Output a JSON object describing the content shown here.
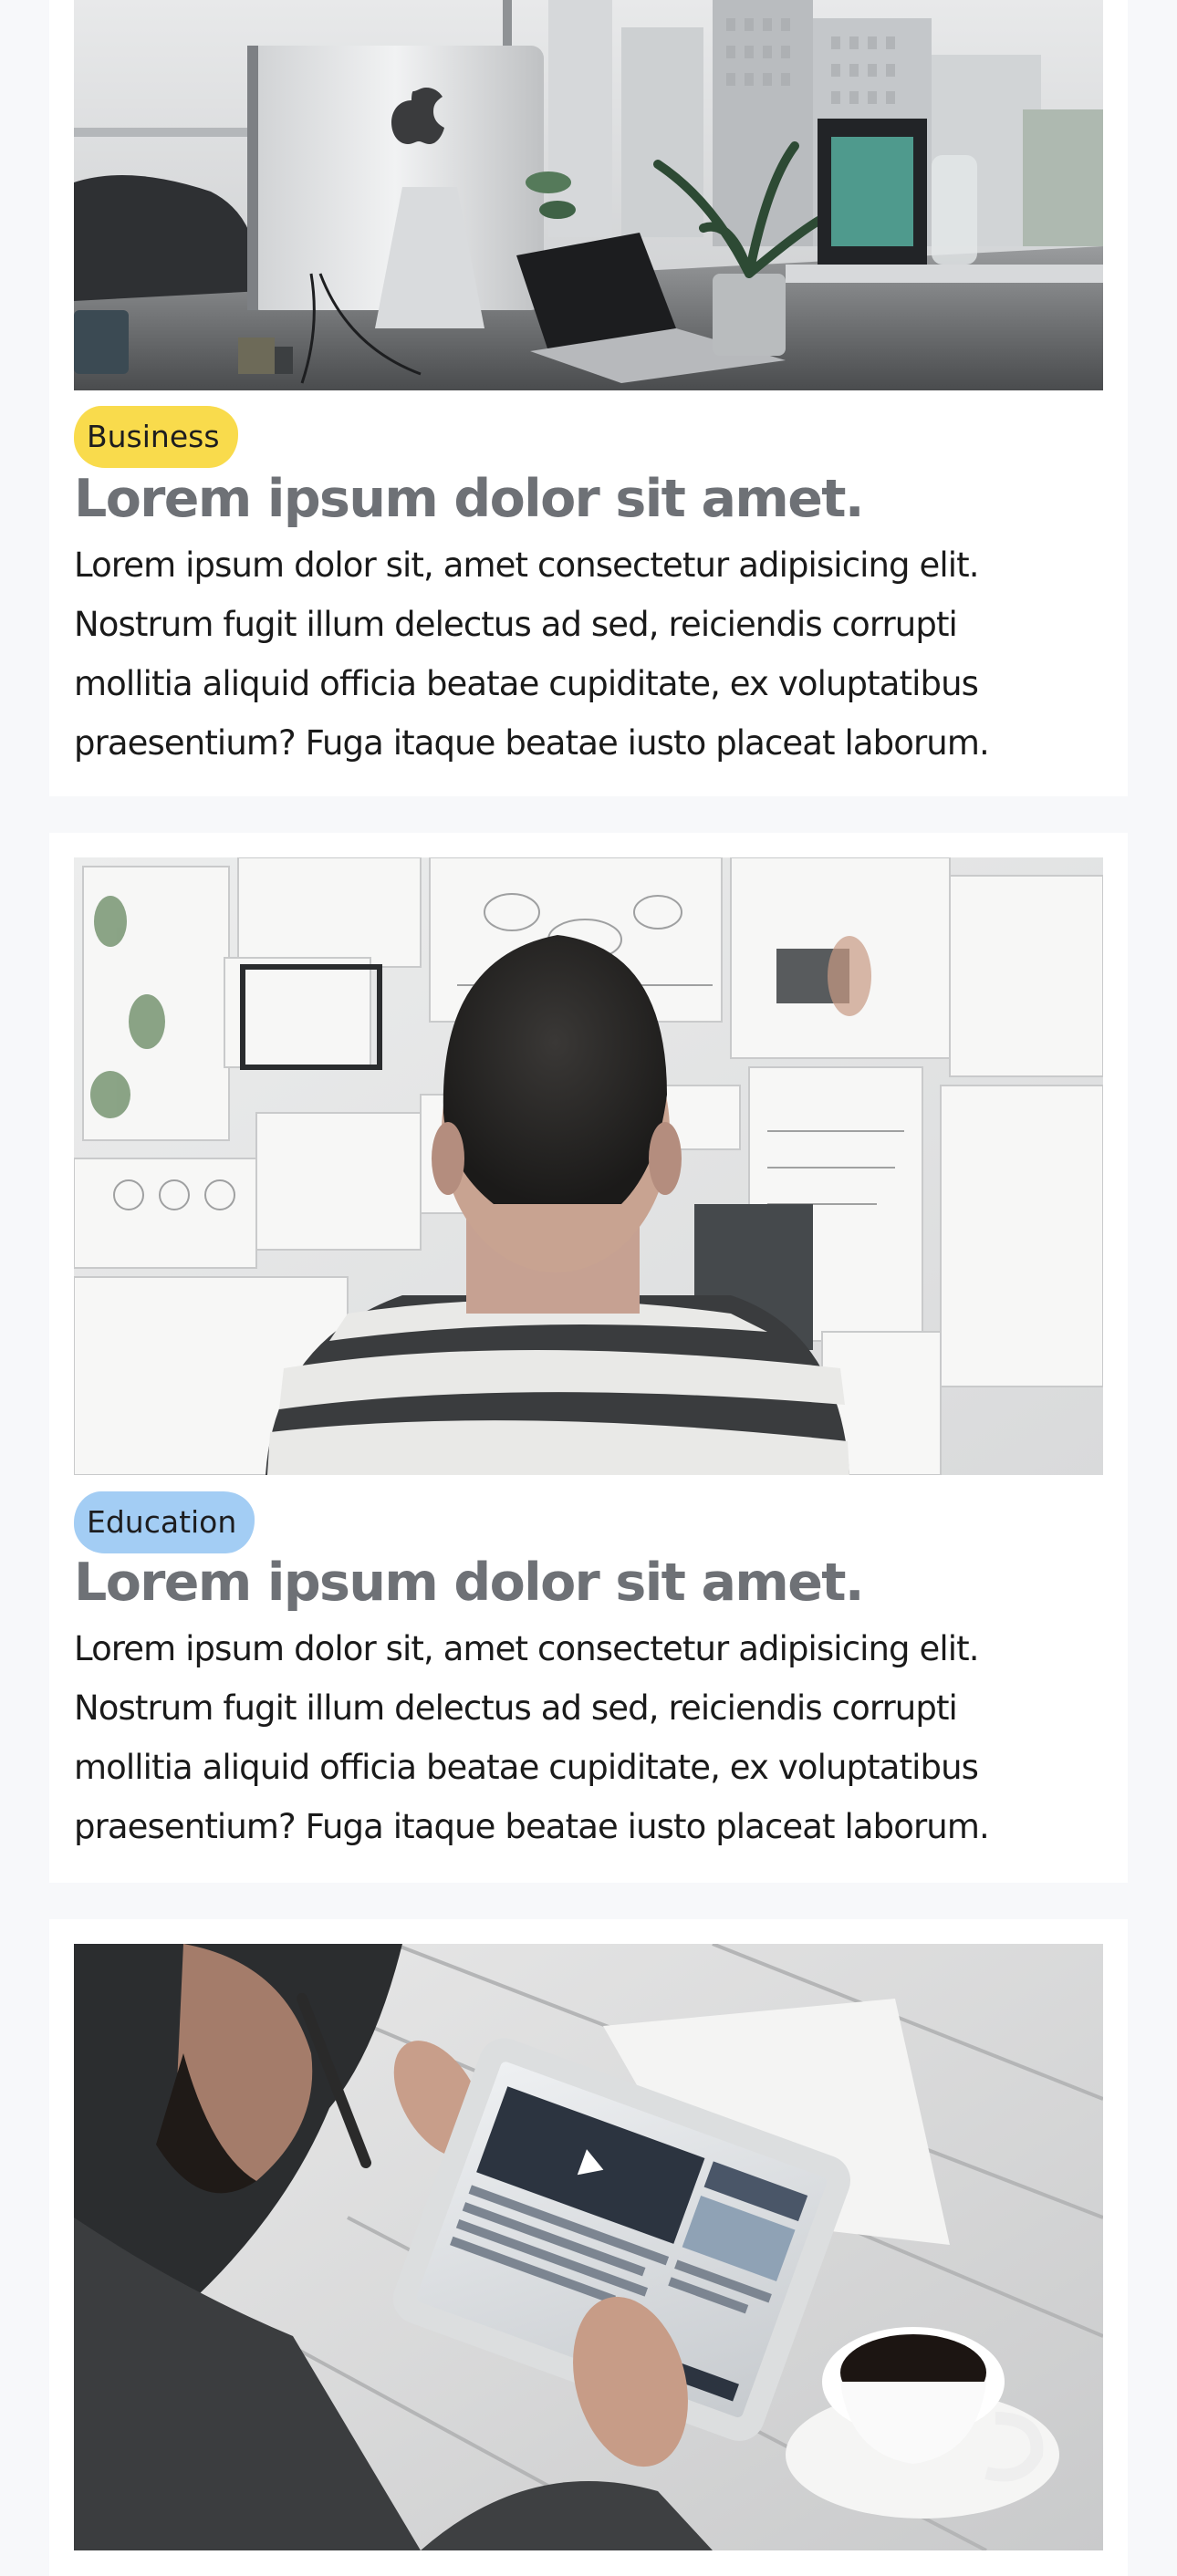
{
  "articles": [
    {
      "image": {
        "subject": "desk-computer",
        "alt": ""
      },
      "category": {
        "label": "Business",
        "color": "#f9db4c"
      },
      "title": "Lorem ipsum dolor sit amet.",
      "body_lines": [
        "Lorem ipsum dolor sit, amet consectetur adipisicing elit.",
        "Nostrum fugit illum delectus ad sed, reiciendis corrupti",
        "mollitia aliquid officia beatae cupiditate, ex voluptatibus",
        "praesentium? Fuga itaque beatae iusto placeat laborum."
      ]
    },
    {
      "image": {
        "subject": "man-at-idea-wall",
        "alt": ""
      },
      "category": {
        "label": "Education",
        "color": "#a3cdf4"
      },
      "title": "Lorem ipsum dolor sit amet.",
      "body_lines": [
        "Lorem ipsum dolor sit, amet consectetur adipisicing elit.",
        "Nostrum fugit illum delectus ad sed, reiciendis corrupti",
        "mollitia aliquid officia beatae cupiditate, ex voluptatibus",
        "praesentium? Fuga itaque beatae iusto placeat laborum."
      ]
    },
    {
      "image": {
        "subject": "man-with-tablet-and-coffee",
        "alt": ""
      }
    }
  ],
  "colors": {
    "page_background": "#f7f8fa",
    "card_background": "#ffffff",
    "title": "#6e7176",
    "body_text": "#1a1a1a"
  }
}
